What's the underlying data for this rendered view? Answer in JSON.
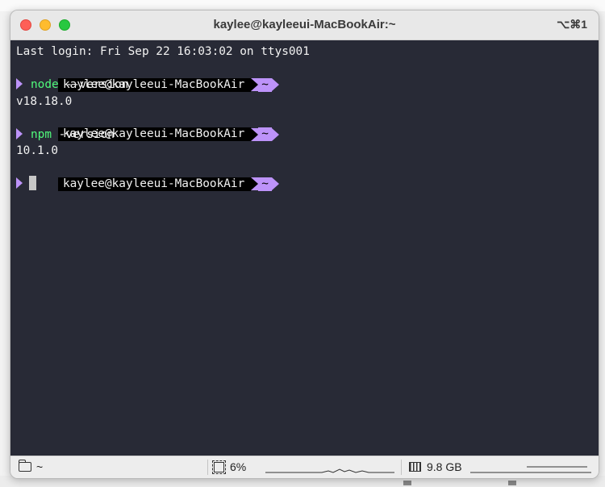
{
  "window": {
    "title": "kaylee@kayleeui-MacBookAir:~",
    "shortcut": "⌥⌘1"
  },
  "terminal": {
    "last_login": "Last login: Fri Sep 22 16:03:02 on ttys001",
    "prompt_user": "kaylee@kayleeui-MacBookAir",
    "prompt_dir": "~",
    "commands": [
      {
        "name": "node",
        "args": " --version",
        "output": "v18.18.0"
      },
      {
        "name": "npm",
        "args": " -version",
        "output": "10.1.0"
      }
    ]
  },
  "statusbar": {
    "directory": "~",
    "cpu": "6%",
    "memory": "9.8 GB"
  },
  "colors": {
    "terminal_bg": "#282a36",
    "prompt_accent": "#bd93f9",
    "command_green": "#50fa7b"
  }
}
